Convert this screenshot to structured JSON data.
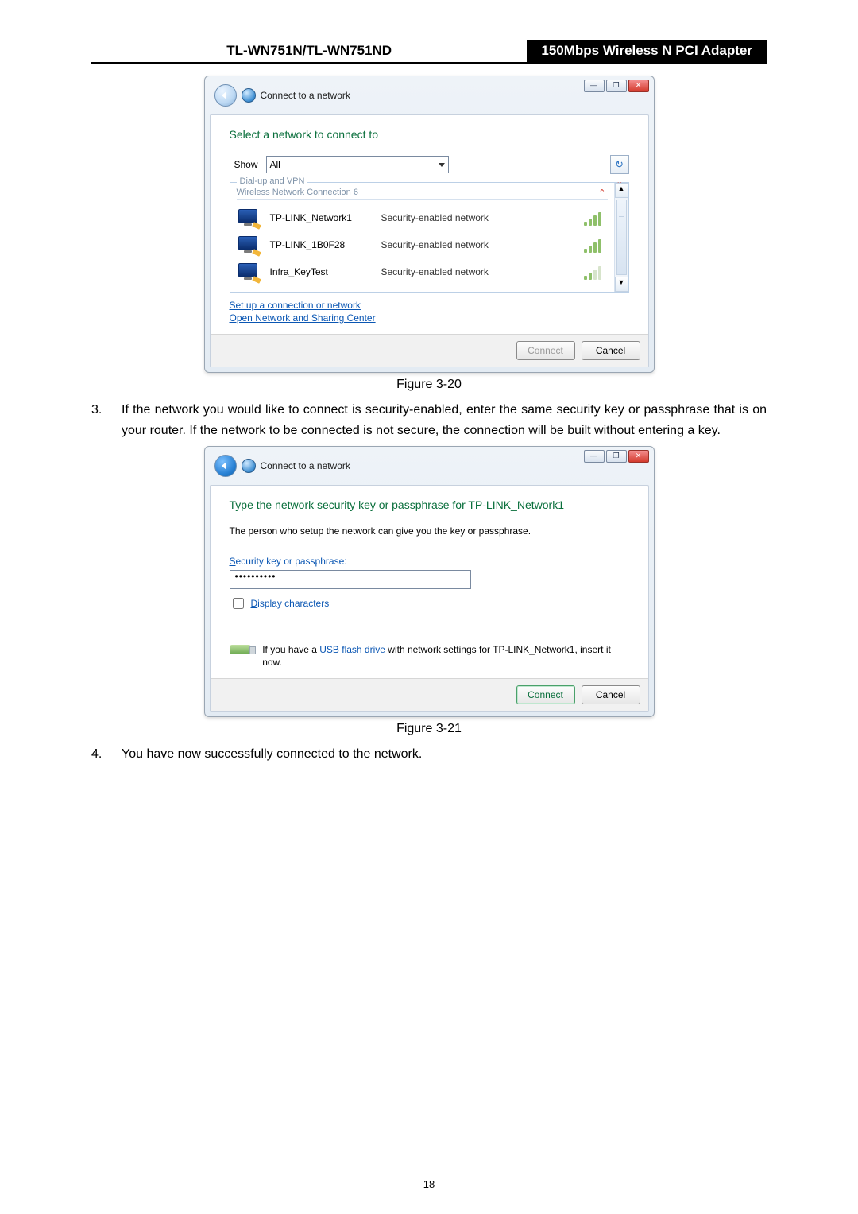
{
  "header": {
    "left": "TL-WN751N/TL-WN751ND",
    "right": "150Mbps Wireless N PCI Adapter"
  },
  "fig1": {
    "windowTitle": "Connect to a network",
    "heading": "Select a network to connect to",
    "showLabel": "Show",
    "showValue": "All",
    "group1": "Dial-up and VPN",
    "group2": "Wireless Network Connection 6",
    "networks": [
      {
        "name": "TP-LINK_Network1",
        "sec": "Security-enabled network",
        "weak": false
      },
      {
        "name": "TP-LINK_1B0F28",
        "sec": "Security-enabled network",
        "weak": false
      },
      {
        "name": "Infra_KeyTest",
        "sec": "Security-enabled network",
        "weak": true
      }
    ],
    "link1": "Set up a connection or network",
    "link2": "Open Network and Sharing Center",
    "connect": "Connect",
    "cancel": "Cancel",
    "caption": "Figure 3-20"
  },
  "step3": {
    "num": "3.",
    "text": "If the network you would like to connect is security-enabled, enter the same security key or passphrase that is on your router. If the network to be connected is not secure, the connection will be built without entering a key."
  },
  "fig2": {
    "windowTitle": "Connect to a network",
    "heading": "Type the network security key or passphrase for TP-LINK_Network1",
    "sub": "The person who setup the network can give you the key or passphrase.",
    "keyLabel": "Security key or passphrase:",
    "keyValue": "••••••••••",
    "display": "Display characters",
    "usb1": "If you have a ",
    "usbLink": "USB flash drive",
    "usb2": " with network settings for TP-LINK_Network1, insert it now.",
    "connect": "Connect",
    "cancel": "Cancel",
    "caption": "Figure 3-21"
  },
  "step4": {
    "num": "4.",
    "text": "You have now successfully connected to the network."
  },
  "pageNumber": "18"
}
